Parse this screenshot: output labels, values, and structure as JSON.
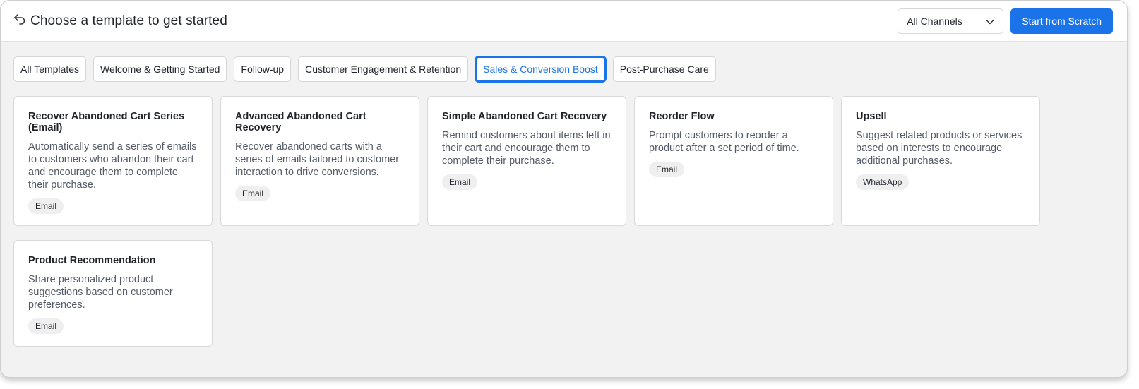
{
  "header": {
    "title": "Choose a template to get started",
    "channel_select": "All Channels",
    "start_button": "Start from Scratch"
  },
  "tabs": [
    {
      "label": "All Templates",
      "active": false
    },
    {
      "label": "Welcome & Getting Started",
      "active": false
    },
    {
      "label": "Follow-up",
      "active": false
    },
    {
      "label": "Customer Engagement & Retention",
      "active": false
    },
    {
      "label": "Sales & Conversion Boost",
      "active": true
    },
    {
      "label": "Post-Purchase Care",
      "active": false
    }
  ],
  "cards": [
    {
      "title": "Recover Abandoned Cart Series (Email)",
      "description": "Automatically send a series of emails to customers who abandon their cart and encourage them to complete their purchase.",
      "channel": "Email"
    },
    {
      "title": "Advanced Abandoned Cart Recovery",
      "description": "Recover abandoned carts with a series of emails tailored to customer interaction to drive conversions.",
      "channel": "Email"
    },
    {
      "title": "Simple Abandoned Cart Recovery",
      "description": "Remind customers about items left in their cart and encourage them to complete their purchase.",
      "channel": "Email"
    },
    {
      "title": "Reorder Flow",
      "description": "Prompt customers to reorder a product after a set period of time.",
      "channel": "Email"
    },
    {
      "title": "Upsell",
      "description": "Suggest related products or services based on interests to encourage additional purchases.",
      "channel": "WhatsApp"
    },
    {
      "title": "Product Recommendation",
      "description": "Share personalized product suggestions based on customer preferences.",
      "channel": "Email"
    }
  ],
  "icons": {
    "back": "back-arrow-icon",
    "dropdown": "chevron-down-icon"
  },
  "colors": {
    "accent": "#1a73e8",
    "background": "#f2f2f2"
  }
}
